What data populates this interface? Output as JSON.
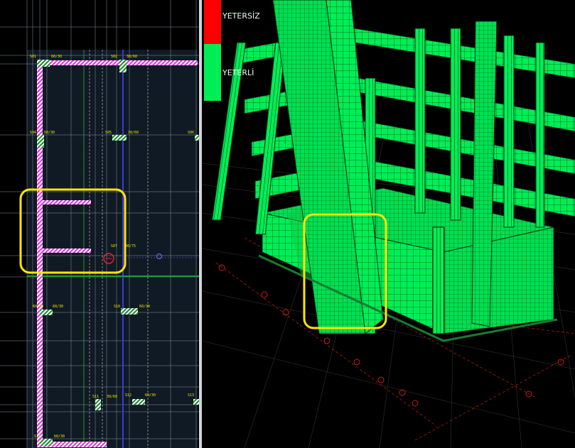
{
  "legend": {
    "items": [
      {
        "label": "YETERSİZ",
        "color": "#ff0000"
      },
      {
        "label": "YETERLİ",
        "color": "#00ee55"
      }
    ]
  },
  "plan": {
    "beam_labels": [
      "60/30",
      "30/60",
      "60/30",
      "30/60",
      "60/30",
      "60/30",
      "60/30",
      "60/30",
      "30/60",
      "60/30",
      "60/30"
    ],
    "column_labels": [
      "S01",
      "S02",
      "S04",
      "S05",
      "S06",
      "S07",
      "S10",
      "S11",
      "S12",
      "S13",
      "S14"
    ],
    "note_label": "30/75"
  },
  "colors": {
    "plan_bg": "#101a24",
    "wall_magenta": "#e22ee2",
    "column_green": "#00ff66",
    "highlight": "#ffe600",
    "mesh_green": "#00ee55",
    "grid_red": "#c42010"
  }
}
